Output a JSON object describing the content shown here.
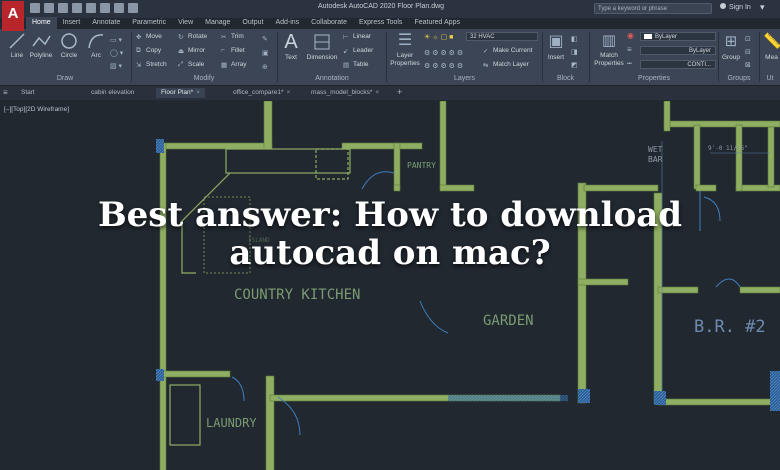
{
  "app": {
    "logo_letter": "A",
    "title": "Autodesk AutoCAD 2020   Floor Plan.dwg",
    "search_placeholder": "Type a keyword or phrase",
    "signin": "Sign In"
  },
  "ribbon_tabs": [
    "Home",
    "Insert",
    "Annotate",
    "Parametric",
    "View",
    "Manage",
    "Output",
    "Add-ins",
    "Collaborate",
    "Express Tools",
    "Featured Apps"
  ],
  "draw_panel": {
    "title": "Draw",
    "buttons": [
      "Line",
      "Polyline",
      "Circle",
      "Arc"
    ]
  },
  "modify_panel": {
    "title": "Modify",
    "rows": [
      [
        "Move",
        "Rotate",
        "Trim"
      ],
      [
        "Copy",
        "Mirror",
        "Fillet"
      ],
      [
        "Stretch",
        "Scale",
        "Array"
      ]
    ]
  },
  "annotation_panel": {
    "title": "Annotation",
    "text": "Text",
    "dimension": "Dimension",
    "items": [
      "Linear",
      "Leader",
      "Table"
    ]
  },
  "layers_panel": {
    "title": "Layers",
    "layer_properties": "Layer Properties",
    "current_layer": "32 HVAC",
    "make_current": "Make Current",
    "match_layer": "Match Layer"
  },
  "block_panel": {
    "title": "Block",
    "insert": "Insert"
  },
  "properties_panel": {
    "title": "Properties",
    "match_properties": "Match Properties",
    "dropdowns": [
      "ByLayer",
      "ByLayer",
      "CONTI..."
    ]
  },
  "groups_panel": {
    "title": "Groups",
    "group": "Group"
  },
  "utilities_panel": {
    "title": "Ut",
    "measure": "Mea"
  },
  "file_tabs": [
    {
      "label": "Start",
      "active": false,
      "closable": false
    },
    {
      "label": "cabin elevation",
      "active": false,
      "closable": false
    },
    {
      "label": "Floor Plan*",
      "active": true,
      "closable": true
    },
    {
      "label": "office_compare1*",
      "active": false,
      "closable": true
    },
    {
      "label": "mass_model_blocks*",
      "active": false,
      "closable": true
    }
  ],
  "viewport_label": "[–][Top][2D Wireframe]",
  "rooms": {
    "pantry": "PANTRY",
    "island": "ISLAND",
    "country_kitchen": "COUNTRY KITCHEN",
    "garden": "GARDEN",
    "laundry": "LAUNDRY",
    "br2": "B.R. #2",
    "wet_bar_1": "WET",
    "wet_bar_2": "BAR",
    "dimension": "9'-0 11/16\""
  },
  "headline_line1": "Best answer: How to download",
  "headline_line2": "autocad on mac?",
  "colors": {
    "titlebar": "#2b3340",
    "ribbon": "#3b4556",
    "viewport": "#212830",
    "wall": "#8fae62",
    "hatch": "#3f7fbf",
    "logo": "#b8262b"
  }
}
